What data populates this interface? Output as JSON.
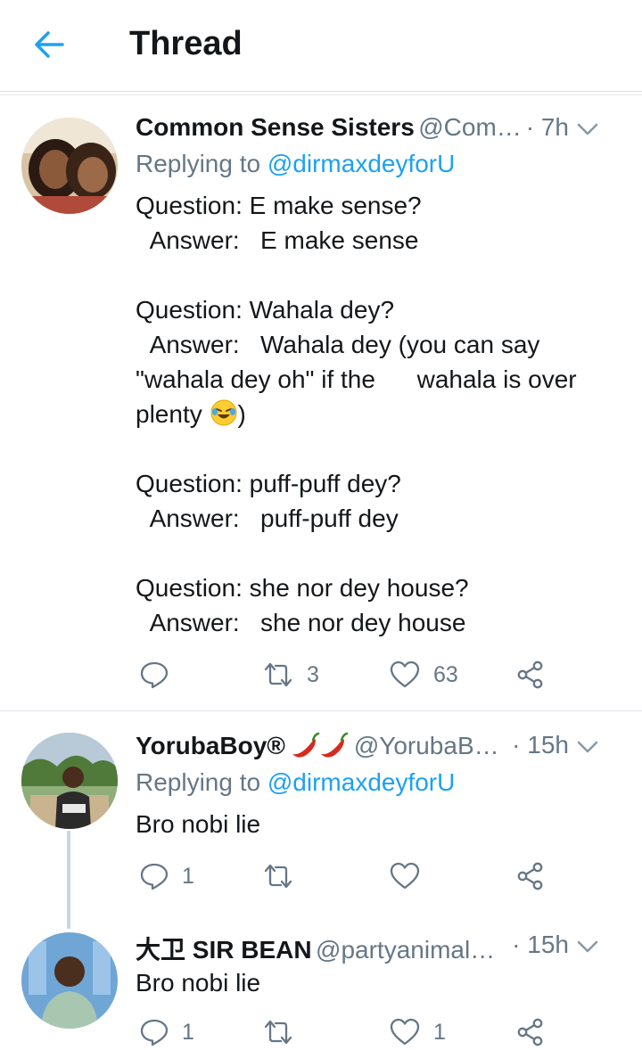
{
  "header": {
    "title": "Thread"
  },
  "tweets": [
    {
      "name": "Common Sense Sisters",
      "handle": "@Com…",
      "time": "· 7h",
      "replying_label": "Replying to",
      "replying_to": "@dirmaxdeyforU",
      "body_pre": "Question: E make sense?\n  Answer:   E make sense\n\nQuestion: Wahala dey?\n  Answer:   Wahala dey (you can say \"wahala dey oh\" if the      wahala is over plenty ",
      "body_emoji": "rolling-on-floor-laughing-emoji",
      "body_post": ")\n\nQuestion: puff-puff dey?\n  Answer:   puff-puff dey\n\nQuestion: she nor dey house?\n  Answer:   she nor dey house",
      "reply_count": "",
      "retweet_count": "3",
      "like_count": "63"
    },
    {
      "name": "YorubaBoy®",
      "name_emoji": "chili-pepper-emoji",
      "handle": "@YorubaB…",
      "time": "· 15h",
      "replying_label": "Replying to",
      "replying_to": "@dirmaxdeyforU",
      "body": "Bro nobi lie",
      "reply_count": "1",
      "retweet_count": "",
      "like_count": ""
    },
    {
      "name": "大卫 SIR BEAN",
      "handle": "@partyanimal…",
      "time": "· 15h",
      "body": "Bro nobi lie",
      "reply_count": "1",
      "retweet_count": "",
      "like_count": "1"
    }
  ],
  "colors": {
    "accent": "#1da1f2",
    "muted": "#657786",
    "text": "#14171a",
    "divider": "#e1e8ed"
  }
}
